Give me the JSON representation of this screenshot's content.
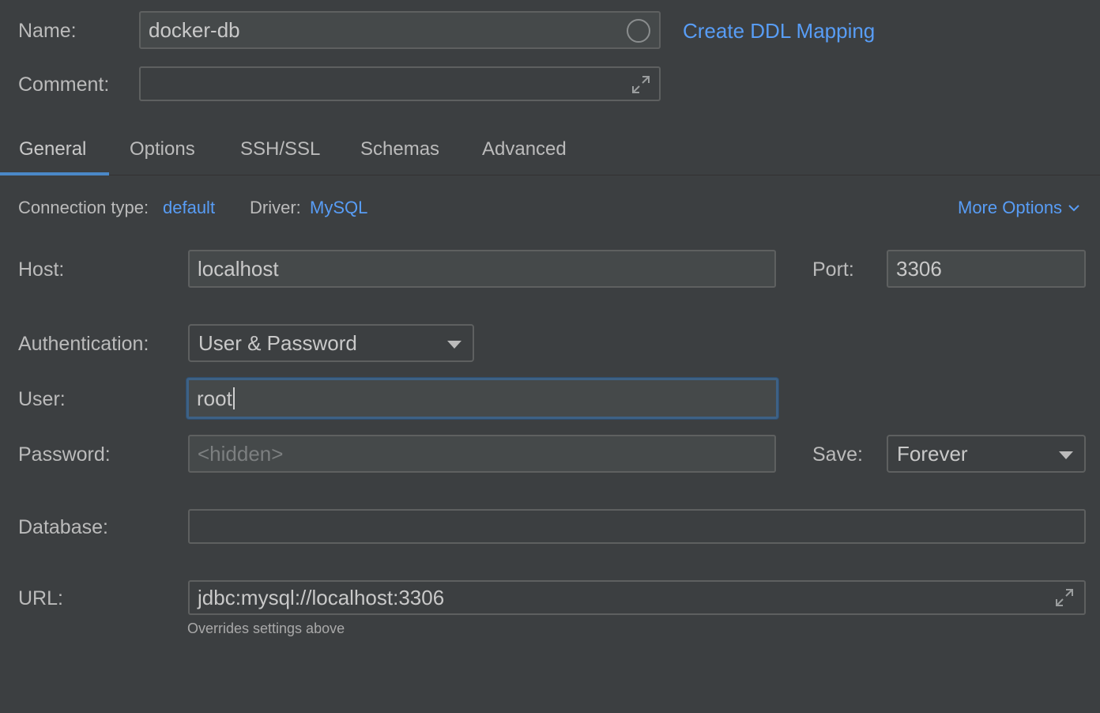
{
  "header": {
    "name_label": "Name:",
    "name_value": "docker-db",
    "create_ddl_link": "Create DDL Mapping",
    "comment_label": "Comment:",
    "comment_value": ""
  },
  "tabs": [
    {
      "label": "General",
      "active": true
    },
    {
      "label": "Options",
      "active": false
    },
    {
      "label": "SSH/SSL",
      "active": false
    },
    {
      "label": "Schemas",
      "active": false
    },
    {
      "label": "Advanced",
      "active": false
    }
  ],
  "connection": {
    "type_label": "Connection type:",
    "type_value": "default",
    "driver_label": "Driver:",
    "driver_value": "MySQL",
    "more_options": "More Options"
  },
  "form": {
    "host_label": "Host:",
    "host_value": "localhost",
    "port_label": "Port:",
    "port_value": "3306",
    "auth_label": "Authentication:",
    "auth_value": "User & Password",
    "user_label": "User:",
    "user_value": "root",
    "password_label": "Password:",
    "password_placeholder": "<hidden>",
    "save_label": "Save:",
    "save_value": "Forever",
    "database_label": "Database:",
    "database_value": "",
    "url_label": "URL:",
    "url_value": "jdbc:mysql://localhost:3306",
    "url_note": "Overrides settings above"
  },
  "icons": {
    "status": "circle-icon",
    "expand": "expand-icon",
    "chevron": "chevron-down-icon",
    "dropdown_caret": "caret-down-icon"
  },
  "colors": {
    "background": "#3c3f41",
    "field_bg": "#45494a",
    "link": "#589df6",
    "tab_underline": "#4a88c7",
    "focus_border": "#3d6185"
  }
}
